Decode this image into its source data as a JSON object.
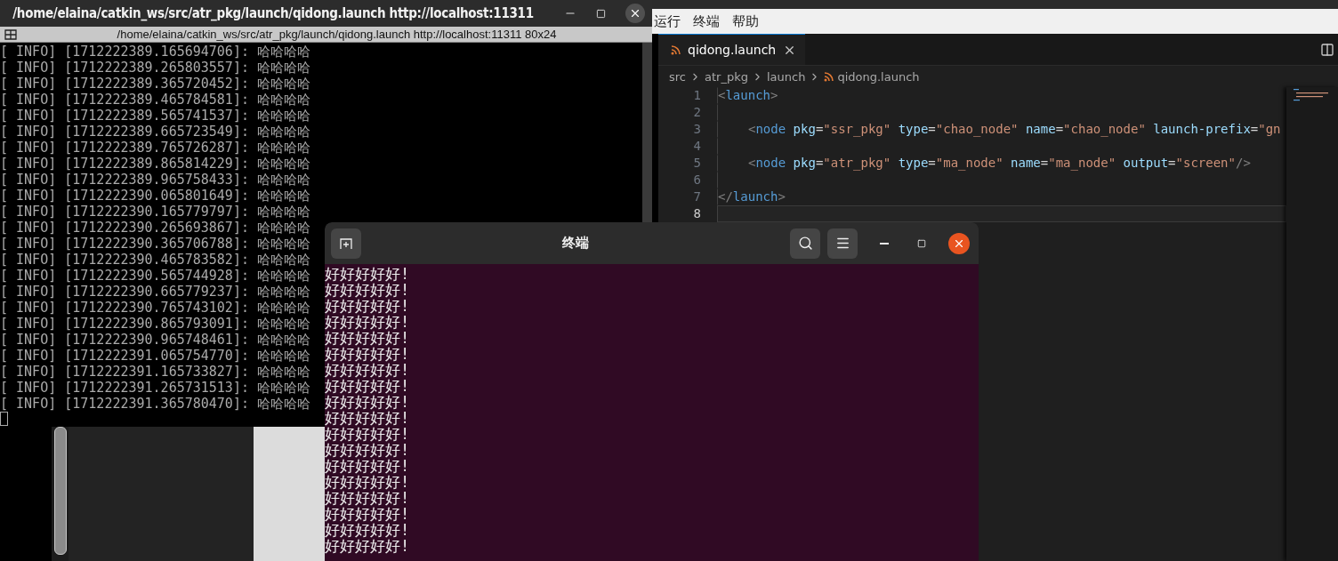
{
  "xterm": {
    "title": "/home/elaina/catkin_ws/src/atr_pkg/launch/qidong.launch http://localhost:11311",
    "subtitle": "/home/elaina/catkin_ws/src/atr_pkg/launch/qidong.launch http://localhost:11311 80x24",
    "lines": [
      "[ INFO] [1712222389.165694706]: 哈哈哈哈",
      "[ INFO] [1712222389.265803557]: 哈哈哈哈",
      "[ INFO] [1712222389.365720452]: 哈哈哈哈",
      "[ INFO] [1712222389.465784581]: 哈哈哈哈",
      "[ INFO] [1712222389.565741537]: 哈哈哈哈",
      "[ INFO] [1712222389.665723549]: 哈哈哈哈",
      "[ INFO] [1712222389.765726287]: 哈哈哈哈",
      "[ INFO] [1712222389.865814229]: 哈哈哈哈",
      "[ INFO] [1712222389.965758433]: 哈哈哈哈",
      "[ INFO] [1712222390.065801649]: 哈哈哈哈",
      "[ INFO] [1712222390.165779797]: 哈哈哈哈",
      "[ INFO] [1712222390.265693867]: 哈哈哈哈",
      "[ INFO] [1712222390.365706788]: 哈哈哈哈",
      "[ INFO] [1712222390.465783582]: 哈哈哈哈",
      "[ INFO] [1712222390.565744928]: 哈哈哈哈",
      "[ INFO] [1712222390.665779237]: 哈哈哈哈",
      "[ INFO] [1712222390.765743102]: 哈哈哈哈",
      "[ INFO] [1712222390.865793091]: 哈哈哈哈",
      "[ INFO] [1712222390.965748461]: 哈哈哈哈",
      "[ INFO] [1712222391.065754770]: 哈哈哈哈",
      "[ INFO] [1712222391.165733827]: 哈哈哈哈",
      "[ INFO] [1712222391.265731513]: 哈哈哈哈",
      "[ INFO] [1712222391.365780470]: 哈哈哈哈"
    ]
  },
  "vscode": {
    "menu": [
      "运行",
      "终端",
      "帮助"
    ],
    "tabs": [
      {
        "label": "qidong.launch",
        "selected": true
      }
    ],
    "breadcrumbs": [
      "src",
      "atr_pkg",
      "launch",
      "qidong.launch"
    ],
    "code_lines": [
      {
        "number": "1",
        "selected": false,
        "indented": false,
        "tokens": [
          {
            "kind": "bracket",
            "text": "<"
          },
          {
            "kind": "tag",
            "text": "launch"
          },
          {
            "kind": "bracket",
            "text": ">"
          }
        ]
      },
      {
        "number": "2",
        "selected": false
      },
      {
        "number": "3",
        "selected": false,
        "indented": true,
        "tokens": [
          {
            "kind": "bracket",
            "text": "<"
          },
          {
            "kind": "tag",
            "text": "node "
          },
          {
            "kind": "attr",
            "text": "pkg"
          },
          {
            "kind": "op",
            "text": "="
          },
          {
            "kind": "string",
            "text": "\"ssr_pkg\" "
          },
          {
            "kind": "attr",
            "text": "type"
          },
          {
            "kind": "op",
            "text": "="
          },
          {
            "kind": "string",
            "text": "\"chao_node\" "
          },
          {
            "kind": "attr",
            "text": "name"
          },
          {
            "kind": "op",
            "text": "="
          },
          {
            "kind": "string",
            "text": "\"chao_node\" "
          },
          {
            "kind": "attr",
            "text": "launch-prefix"
          },
          {
            "kind": "op",
            "text": "="
          },
          {
            "kind": "string",
            "text": "\"gn"
          }
        ]
      },
      {
        "number": "4",
        "selected": false
      },
      {
        "number": "5",
        "selected": false,
        "indented": true,
        "tokens": [
          {
            "kind": "bracket",
            "text": "<"
          },
          {
            "kind": "tag",
            "text": "node "
          },
          {
            "kind": "attr",
            "text": "pkg"
          },
          {
            "kind": "op",
            "text": "="
          },
          {
            "kind": "string",
            "text": "\"atr_pkg\" "
          },
          {
            "kind": "attr",
            "text": "type"
          },
          {
            "kind": "op",
            "text": "="
          },
          {
            "kind": "string",
            "text": "\"ma_node\" "
          },
          {
            "kind": "attr",
            "text": "name"
          },
          {
            "kind": "op",
            "text": "="
          },
          {
            "kind": "string",
            "text": "\"ma_node\" "
          },
          {
            "kind": "attr",
            "text": "output"
          },
          {
            "kind": "op",
            "text": "="
          },
          {
            "kind": "string",
            "text": "\"screen\""
          },
          {
            "kind": "bracket",
            "text": "/>"
          }
        ]
      },
      {
        "number": "6",
        "selected": false
      },
      {
        "number": "7",
        "selected": false,
        "indented": false,
        "tokens": [
          {
            "kind": "bracket",
            "text": "</"
          },
          {
            "kind": "tag",
            "text": "launch"
          },
          {
            "kind": "bracket",
            "text": ">"
          }
        ]
      },
      {
        "number": "8",
        "selected": true
      }
    ]
  },
  "terminal": {
    "title": "终端",
    "lines": [
      "好好好好好!",
      "好好好好好!",
      "好好好好好!",
      "好好好好好!",
      "好好好好好!",
      "好好好好好!",
      "好好好好好!",
      "好好好好好!",
      "好好好好好!",
      "好好好好好!",
      "好好好好好!",
      "好好好好好!",
      "好好好好好!",
      "好好好好好!",
      "好好好好好!",
      "好好好好好!",
      "好好好好好!",
      "好好好好好!"
    ]
  }
}
